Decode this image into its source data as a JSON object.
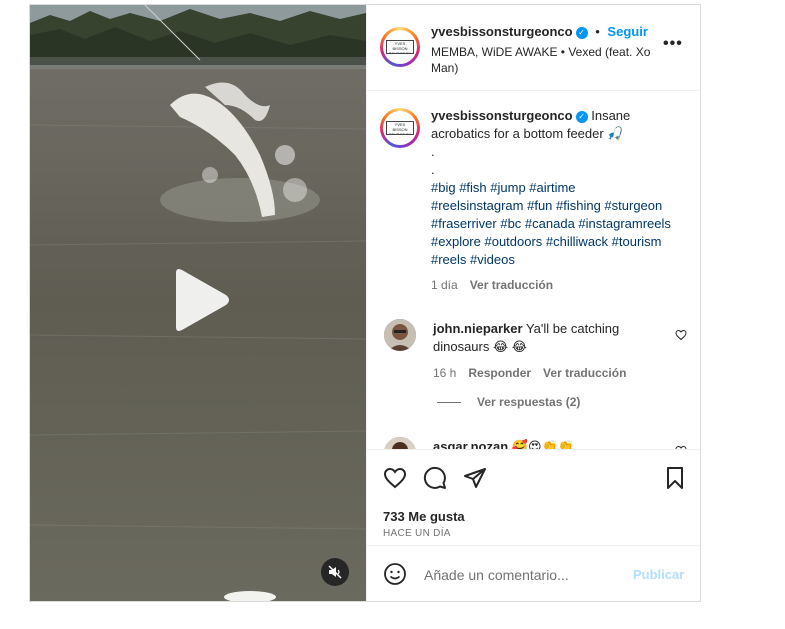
{
  "post": {
    "username": "yvesbissonsturgeonco",
    "follow_label": "Seguir",
    "audio": "MEMBA, WiDE AWAKE • Vexed (feat. Xo Man)",
    "more_icon": "more-options-icon",
    "avatar_logo_text": "YVES BISSON STURGEON CO"
  },
  "caption": {
    "username": "yvesbissonsturgeonco",
    "text": "Insane acrobatics for a bottom feeder 🎣",
    "dot1": ".",
    "dot2": ".",
    "hashtags": "#big #fish #jump #airtime #reelsinstagram #fun #fishing #sturgeon #fraserriver #bc #canada #instagramreels #explore #outdoors #chilliwack #tourism #reels #videos",
    "time": "1 día",
    "translate": "Ver traducción"
  },
  "comments": [
    {
      "username": "john.nieparker",
      "text": "Ya'll be catching dinosaurs 😂 😂",
      "time": "16 h",
      "reply": "Responder",
      "translate": "Ver traducción",
      "view_replies": "Ver respuestas (2)"
    },
    {
      "username": "asgar.nozan",
      "text": "🥰😍👏👏"
    }
  ],
  "actions": {
    "likes": "733 Me gusta",
    "ago": "HACE UN DÍA"
  },
  "add_comment": {
    "placeholder": "Añade un comentario...",
    "publish_label": "Publicar"
  },
  "colors": {
    "link": "#0095f6",
    "hashtag": "#00376b",
    "muted": "#737373",
    "publish_disabled": "#b2dffc"
  }
}
